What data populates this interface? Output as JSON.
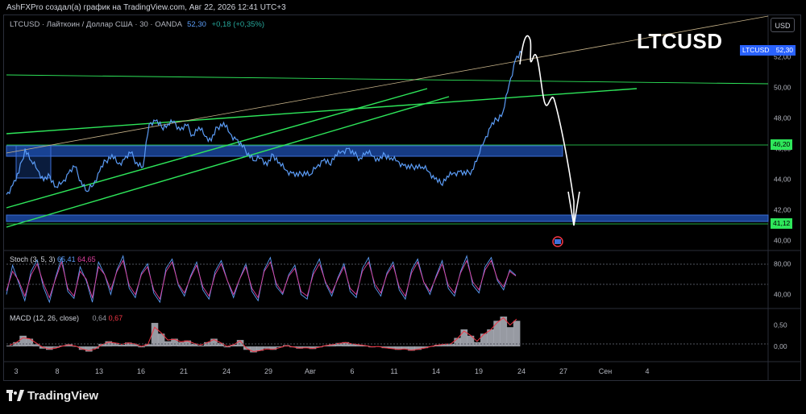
{
  "header": {
    "attribution": "AshFXPro создал(а) график на TradingView.com, Авг 22, 2026 12:41 UTC+3"
  },
  "symbol_bar": {
    "title": "LTCUSD · Лайткоин / Доллар США · 30 · OANDA",
    "price": "52,30",
    "change": "+0,18 (+0,35%)"
  },
  "annotation_title": "LTCUSD",
  "currency_button": "USD",
  "price_tags": {
    "symbol": "LTCUSD",
    "last": "52,30",
    "level_upper": "46,20",
    "level_lower": "41,12"
  },
  "stoch": {
    "label": "Stoch (3, 5, 3)",
    "k": "65,41",
    "d": "64,65"
  },
  "macd": {
    "label": "MACD (12, 26, close)",
    "macd": "0,64",
    "signal": "0,67"
  },
  "branding": {
    "logo_text": "TradingView"
  },
  "colors": {
    "price_line": "#5b9cf6",
    "zone": "#1e4fb0",
    "trend": "#2ee65a",
    "stoch_k": "#5b9cf6",
    "stoch_d": "#e040a0",
    "macd_hist": "#b2b5be",
    "macd_line": "#f23645"
  },
  "chart_data": [
    {
      "type": "line",
      "name": "price",
      "x_ticks": [
        "3",
        "8",
        "13",
        "16",
        "21",
        "24",
        "29",
        "Авг",
        "6",
        "11",
        "14",
        "19",
        "24",
        "27",
        "Сен",
        "4"
      ],
      "y_ticks": [
        "40,00",
        "42,00",
        "44,00",
        "46,00",
        "48,00",
        "50,00",
        "52,00"
      ],
      "ylim": [
        39.5,
        53.5
      ],
      "points": [
        [
          0,
          43.0
        ],
        [
          1,
          43.6
        ],
        [
          2,
          44.4
        ],
        [
          3,
          46.0
        ],
        [
          4,
          45.2
        ],
        [
          5,
          44.6
        ],
        [
          6,
          43.9
        ],
        [
          7,
          44.2
        ],
        [
          8,
          43.5
        ],
        [
          9,
          43.8
        ],
        [
          10,
          44.4
        ],
        [
          11,
          44.8
        ],
        [
          12,
          43.9
        ],
        [
          13,
          43.2
        ],
        [
          14,
          43.6
        ],
        [
          15,
          44.5
        ],
        [
          16,
          45.2
        ],
        [
          17,
          45.6
        ],
        [
          18,
          45.0
        ],
        [
          19,
          45.3
        ],
        [
          20,
          45.7
        ],
        [
          21,
          45.1
        ],
        [
          22,
          44.8
        ],
        [
          23,
          47.6
        ],
        [
          24,
          47.8
        ],
        [
          25,
          47.4
        ],
        [
          26,
          47.6
        ],
        [
          27,
          47.8
        ],
        [
          28,
          47.2
        ],
        [
          29,
          47.5
        ],
        [
          30,
          46.9
        ],
        [
          31,
          47.4
        ],
        [
          32,
          46.8
        ],
        [
          33,
          46.5
        ],
        [
          34,
          47.4
        ],
        [
          35,
          47.7
        ],
        [
          36,
          47.0
        ],
        [
          37,
          46.6
        ],
        [
          38,
          46.1
        ],
        [
          39,
          45.7
        ],
        [
          40,
          45.2
        ],
        [
          41,
          45.4
        ],
        [
          42,
          44.9
        ],
        [
          43,
          45.6
        ],
        [
          44,
          45.1
        ],
        [
          45,
          44.6
        ],
        [
          46,
          44.4
        ],
        [
          47,
          44.2
        ],
        [
          48,
          44.5
        ],
        [
          49,
          44.3
        ],
        [
          50,
          44.8
        ],
        [
          51,
          45.2
        ],
        [
          52,
          45.0
        ],
        [
          53,
          45.6
        ],
        [
          54,
          45.8
        ],
        [
          55,
          46.0
        ],
        [
          56,
          45.6
        ],
        [
          57,
          45.4
        ],
        [
          58,
          45.8
        ],
        [
          59,
          45.5
        ],
        [
          60,
          45.2
        ],
        [
          61,
          45.6
        ],
        [
          62,
          45.4
        ],
        [
          63,
          45.2
        ],
        [
          64,
          44.9
        ],
        [
          65,
          44.7
        ],
        [
          66,
          44.9
        ],
        [
          67,
          44.8
        ],
        [
          68,
          44.5
        ],
        [
          69,
          44.0
        ],
        [
          70,
          43.7
        ],
        [
          71,
          44.2
        ],
        [
          72,
          44.4
        ],
        [
          73,
          44.5
        ],
        [
          74,
          44.3
        ],
        [
          75,
          44.6
        ],
        [
          76,
          45.5
        ],
        [
          77,
          46.5
        ],
        [
          78,
          47.4
        ],
        [
          79,
          47.9
        ],
        [
          80,
          48.4
        ],
        [
          81,
          50.2
        ],
        [
          82,
          51.8
        ],
        [
          83,
          52.3
        ]
      ],
      "x_range": [
        0,
        130
      ],
      "ylabel": ""
    },
    {
      "type": "line",
      "name": "Stoch",
      "y_ticks": [
        "40,00",
        "80,00"
      ],
      "ylim": [
        25,
        95
      ],
      "series": [
        {
          "name": "k",
          "values": [
            40,
            78,
            55,
            32,
            70,
            85,
            50,
            30,
            62,
            88,
            44,
            35,
            76,
            58,
            30,
            82,
            66,
            40,
            72,
            90,
            48,
            36,
            68,
            80,
            42,
            30,
            74,
            86,
            52,
            38,
            64,
            82,
            46,
            34,
            70,
            84,
            58,
            36,
            60,
            80,
            44,
            32,
            72,
            88,
            50,
            40,
            66,
            78,
            40,
            34,
            70,
            86,
            54,
            38,
            62,
            80,
            44,
            36,
            74,
            88,
            50,
            38,
            68,
            82,
            46,
            34,
            72,
            86,
            56,
            40,
            64,
            84,
            48,
            38,
            70,
            90,
            52,
            42,
            76,
            88,
            58,
            46,
            72,
            65
          ]
        },
        {
          "name": "d",
          "values": [
            45,
            70,
            58,
            38,
            65,
            80,
            55,
            36,
            60,
            82,
            48,
            38,
            70,
            60,
            36,
            76,
            66,
            46,
            70,
            84,
            52,
            40,
            66,
            76,
            46,
            34,
            70,
            82,
            54,
            42,
            62,
            78,
            50,
            38,
            66,
            80,
            58,
            40,
            60,
            76,
            48,
            36,
            70,
            82,
            54,
            42,
            64,
            74,
            44,
            38,
            66,
            80,
            56,
            42,
            60,
            76,
            48,
            40,
            70,
            82,
            54,
            42,
            66,
            78,
            50,
            38,
            68,
            82,
            56,
            44,
            62,
            80,
            52,
            42,
            68,
            84,
            56,
            46,
            72,
            84,
            60,
            50,
            70,
            64
          ]
        }
      ]
    },
    {
      "type": "bar",
      "name": "MACD",
      "y_ticks": [
        "0,00",
        "0,50"
      ],
      "ylim": [
        -0.3,
        0.85
      ],
      "histogram": [
        0.02,
        0.1,
        0.25,
        0.18,
        0.05,
        -0.05,
        -0.08,
        -0.03,
        0.02,
        0.05,
        0.0,
        -0.08,
        -0.12,
        -0.05,
        0.06,
        0.12,
        0.08,
        0.04,
        0.09,
        0.05,
        -0.02,
        0.05,
        0.55,
        0.3,
        0.12,
        0.18,
        0.1,
        0.14,
        0.06,
        0.02,
        0.1,
        0.18,
        0.08,
        -0.02,
        0.04,
        0.15,
        -0.08,
        -0.14,
        -0.1,
        -0.05,
        -0.08,
        -0.02,
        0.03,
        -0.02,
        -0.05,
        -0.03,
        -0.06,
        -0.02,
        0.02,
        0.05,
        0.08,
        0.1,
        0.06,
        0.04,
        0.02,
        -0.02,
        0.0,
        -0.04,
        -0.05,
        -0.08,
        -0.06,
        -0.1,
        -0.08,
        -0.04,
        0.0,
        0.04,
        0.05,
        0.06,
        0.2,
        0.4,
        0.25,
        0.1,
        0.3,
        0.4,
        0.6,
        0.7,
        0.45,
        0.6
      ],
      "line": [
        0.03,
        0.09,
        0.2,
        0.18,
        0.08,
        -0.02,
        -0.06,
        -0.04,
        0.01,
        0.04,
        0.01,
        -0.06,
        -0.1,
        -0.06,
        0.04,
        0.1,
        0.08,
        0.05,
        0.08,
        0.06,
        0.0,
        0.05,
        0.45,
        0.32,
        0.15,
        0.17,
        0.11,
        0.13,
        0.07,
        0.03,
        0.09,
        0.16,
        0.09,
        0.0,
        0.04,
        0.13,
        -0.05,
        -0.12,
        -0.1,
        -0.06,
        -0.07,
        -0.03,
        0.02,
        -0.01,
        -0.04,
        -0.03,
        -0.05,
        -0.02,
        0.02,
        0.04,
        0.07,
        0.09,
        0.06,
        0.04,
        0.02,
        -0.01,
        0.0,
        -0.03,
        -0.05,
        -0.07,
        -0.06,
        -0.09,
        -0.07,
        -0.04,
        0.0,
        0.03,
        0.05,
        0.06,
        0.18,
        0.36,
        0.26,
        0.12,
        0.28,
        0.38,
        0.55,
        0.67,
        0.5,
        0.64
      ]
    }
  ]
}
